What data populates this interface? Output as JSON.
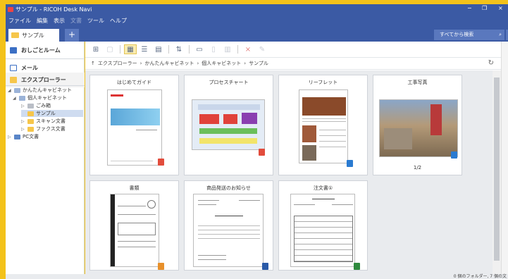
{
  "window": {
    "title": "サンプル - RICOH Desk Navi",
    "minimize": "−",
    "maximize": "❐",
    "close": "×"
  },
  "menu": {
    "items": [
      "ファイル",
      "編集",
      "表示",
      "文書",
      "ツール",
      "ヘルプ"
    ]
  },
  "tabs": {
    "active_label": "サンプル",
    "add_label": "+",
    "search_placeholder": "すべてから検索",
    "search_icon": "magnifier-icon"
  },
  "sidebar": {
    "office_room": "おしごとルーム",
    "mail": "メール",
    "explorer": "エクスプローラー",
    "tree": [
      {
        "label": "かんたんキャビネット",
        "level": 0
      },
      {
        "label": "個人キャビネット",
        "level": 1
      },
      {
        "label": "ごみ箱",
        "level": 2
      },
      {
        "label": "サンプル",
        "level": 2,
        "selected": true
      },
      {
        "label": "スキャン文書",
        "level": 2
      },
      {
        "label": "ファクス文書",
        "level": 2
      },
      {
        "label": "PC文書",
        "level": 0
      }
    ]
  },
  "breadcrumb": {
    "up_icon": "↑",
    "items": [
      "エクスプローラー",
      "かんたんキャビネット",
      "個人キャビネット",
      "サンプル"
    ],
    "separator": "›"
  },
  "documents": [
    {
      "title": "はじめてガイド",
      "badge": "pdf",
      "badge_color": "#e24c3c"
    },
    {
      "title": "プロセスチャート",
      "badge": "pdf",
      "badge_color": "#e24c3c"
    },
    {
      "title": "リーフレット",
      "badge": "image",
      "badge_color": "#2a7bd1"
    },
    {
      "title": "工事写真",
      "badge": "image",
      "badge_color": "#2a7bd1",
      "page_count": "1/2"
    },
    {
      "title": "書類",
      "badge": "image",
      "badge_color": "#e8902a"
    },
    {
      "title": "商品発送のお知らせ",
      "badge": "word",
      "badge_color": "#2a5aa8"
    },
    {
      "title": "注文書①",
      "badge": "excel",
      "badge_color": "#2f8a3e"
    }
  ],
  "status": {
    "text": "0 個のフォルダー, 7 個の文"
  },
  "colors": {
    "accent": "#3b5aa4",
    "frame": "#f3c21a",
    "selection": "#cfdcf0"
  }
}
